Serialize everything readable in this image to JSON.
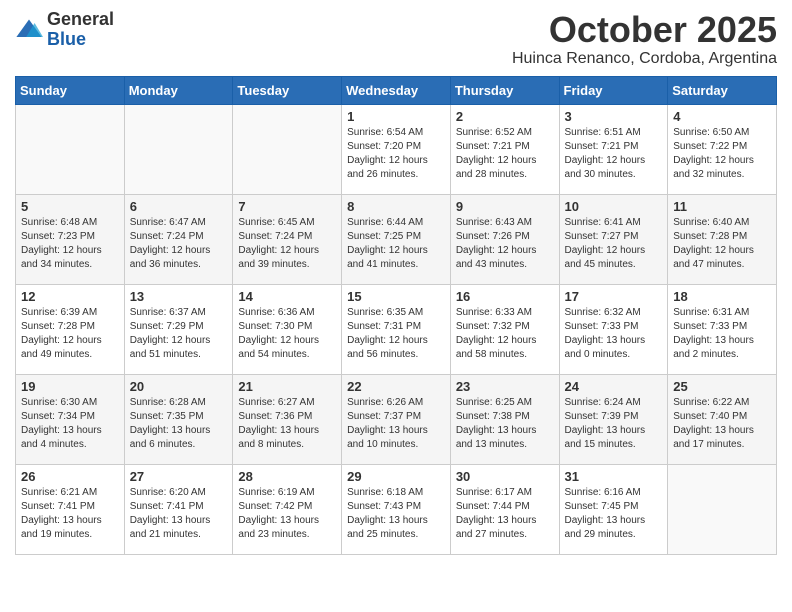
{
  "header": {
    "logo_general": "General",
    "logo_blue": "Blue",
    "month": "October 2025",
    "location": "Huinca Renanco, Cordoba, Argentina"
  },
  "weekdays": [
    "Sunday",
    "Monday",
    "Tuesday",
    "Wednesday",
    "Thursday",
    "Friday",
    "Saturday"
  ],
  "weeks": [
    [
      {
        "day": "",
        "info": ""
      },
      {
        "day": "",
        "info": ""
      },
      {
        "day": "",
        "info": ""
      },
      {
        "day": "1",
        "info": "Sunrise: 6:54 AM\nSunset: 7:20 PM\nDaylight: 12 hours\nand 26 minutes."
      },
      {
        "day": "2",
        "info": "Sunrise: 6:52 AM\nSunset: 7:21 PM\nDaylight: 12 hours\nand 28 minutes."
      },
      {
        "day": "3",
        "info": "Sunrise: 6:51 AM\nSunset: 7:21 PM\nDaylight: 12 hours\nand 30 minutes."
      },
      {
        "day": "4",
        "info": "Sunrise: 6:50 AM\nSunset: 7:22 PM\nDaylight: 12 hours\nand 32 minutes."
      }
    ],
    [
      {
        "day": "5",
        "info": "Sunrise: 6:48 AM\nSunset: 7:23 PM\nDaylight: 12 hours\nand 34 minutes."
      },
      {
        "day": "6",
        "info": "Sunrise: 6:47 AM\nSunset: 7:24 PM\nDaylight: 12 hours\nand 36 minutes."
      },
      {
        "day": "7",
        "info": "Sunrise: 6:45 AM\nSunset: 7:24 PM\nDaylight: 12 hours\nand 39 minutes."
      },
      {
        "day": "8",
        "info": "Sunrise: 6:44 AM\nSunset: 7:25 PM\nDaylight: 12 hours\nand 41 minutes."
      },
      {
        "day": "9",
        "info": "Sunrise: 6:43 AM\nSunset: 7:26 PM\nDaylight: 12 hours\nand 43 minutes."
      },
      {
        "day": "10",
        "info": "Sunrise: 6:41 AM\nSunset: 7:27 PM\nDaylight: 12 hours\nand 45 minutes."
      },
      {
        "day": "11",
        "info": "Sunrise: 6:40 AM\nSunset: 7:28 PM\nDaylight: 12 hours\nand 47 minutes."
      }
    ],
    [
      {
        "day": "12",
        "info": "Sunrise: 6:39 AM\nSunset: 7:28 PM\nDaylight: 12 hours\nand 49 minutes."
      },
      {
        "day": "13",
        "info": "Sunrise: 6:37 AM\nSunset: 7:29 PM\nDaylight: 12 hours\nand 51 minutes."
      },
      {
        "day": "14",
        "info": "Sunrise: 6:36 AM\nSunset: 7:30 PM\nDaylight: 12 hours\nand 54 minutes."
      },
      {
        "day": "15",
        "info": "Sunrise: 6:35 AM\nSunset: 7:31 PM\nDaylight: 12 hours\nand 56 minutes."
      },
      {
        "day": "16",
        "info": "Sunrise: 6:33 AM\nSunset: 7:32 PM\nDaylight: 12 hours\nand 58 minutes."
      },
      {
        "day": "17",
        "info": "Sunrise: 6:32 AM\nSunset: 7:33 PM\nDaylight: 13 hours\nand 0 minutes."
      },
      {
        "day": "18",
        "info": "Sunrise: 6:31 AM\nSunset: 7:33 PM\nDaylight: 13 hours\nand 2 minutes."
      }
    ],
    [
      {
        "day": "19",
        "info": "Sunrise: 6:30 AM\nSunset: 7:34 PM\nDaylight: 13 hours\nand 4 minutes."
      },
      {
        "day": "20",
        "info": "Sunrise: 6:28 AM\nSunset: 7:35 PM\nDaylight: 13 hours\nand 6 minutes."
      },
      {
        "day": "21",
        "info": "Sunrise: 6:27 AM\nSunset: 7:36 PM\nDaylight: 13 hours\nand 8 minutes."
      },
      {
        "day": "22",
        "info": "Sunrise: 6:26 AM\nSunset: 7:37 PM\nDaylight: 13 hours\nand 10 minutes."
      },
      {
        "day": "23",
        "info": "Sunrise: 6:25 AM\nSunset: 7:38 PM\nDaylight: 13 hours\nand 13 minutes."
      },
      {
        "day": "24",
        "info": "Sunrise: 6:24 AM\nSunset: 7:39 PM\nDaylight: 13 hours\nand 15 minutes."
      },
      {
        "day": "25",
        "info": "Sunrise: 6:22 AM\nSunset: 7:40 PM\nDaylight: 13 hours\nand 17 minutes."
      }
    ],
    [
      {
        "day": "26",
        "info": "Sunrise: 6:21 AM\nSunset: 7:41 PM\nDaylight: 13 hours\nand 19 minutes."
      },
      {
        "day": "27",
        "info": "Sunrise: 6:20 AM\nSunset: 7:41 PM\nDaylight: 13 hours\nand 21 minutes."
      },
      {
        "day": "28",
        "info": "Sunrise: 6:19 AM\nSunset: 7:42 PM\nDaylight: 13 hours\nand 23 minutes."
      },
      {
        "day": "29",
        "info": "Sunrise: 6:18 AM\nSunset: 7:43 PM\nDaylight: 13 hours\nand 25 minutes."
      },
      {
        "day": "30",
        "info": "Sunrise: 6:17 AM\nSunset: 7:44 PM\nDaylight: 13 hours\nand 27 minutes."
      },
      {
        "day": "31",
        "info": "Sunrise: 6:16 AM\nSunset: 7:45 PM\nDaylight: 13 hours\nand 29 minutes."
      },
      {
        "day": "",
        "info": ""
      }
    ]
  ]
}
